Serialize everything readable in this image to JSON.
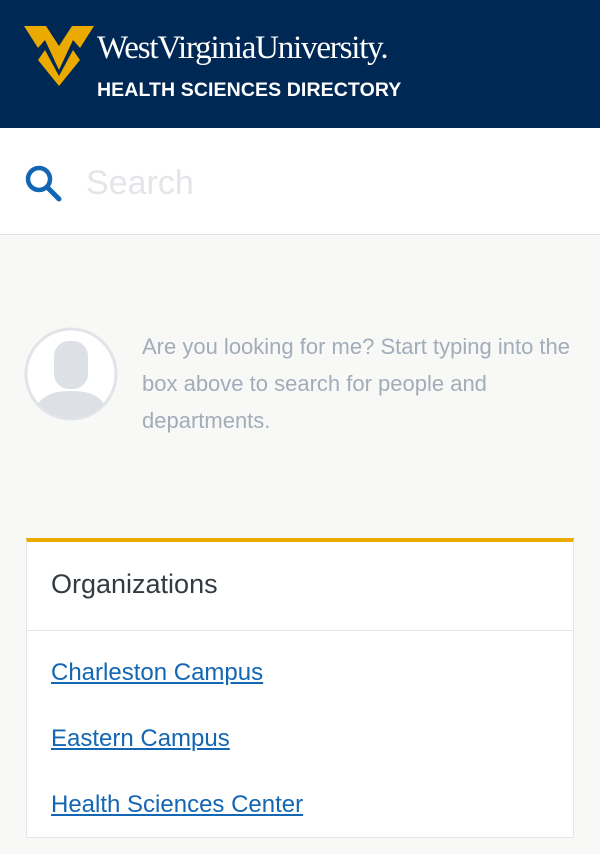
{
  "header": {
    "brand_name": "WestVirginiaUniversity.",
    "subtitle": "HEALTH SCIENCES DIRECTORY",
    "logo_icon": "wv-flying-wv-logo-icon",
    "colors": {
      "navy": "#002855",
      "gold": "#eaaa00"
    }
  },
  "search": {
    "icon": "search-icon",
    "placeholder": "Search",
    "value": ""
  },
  "prompt": {
    "avatar_icon": "person-avatar-icon",
    "text": "Are you looking for me? Start typing into the box above to search for people and departments."
  },
  "organizations": {
    "title": "Organizations",
    "items": [
      {
        "label": "Charleston Campus"
      },
      {
        "label": "Eastern Campus"
      },
      {
        "label": "Health Sciences Center"
      }
    ]
  }
}
